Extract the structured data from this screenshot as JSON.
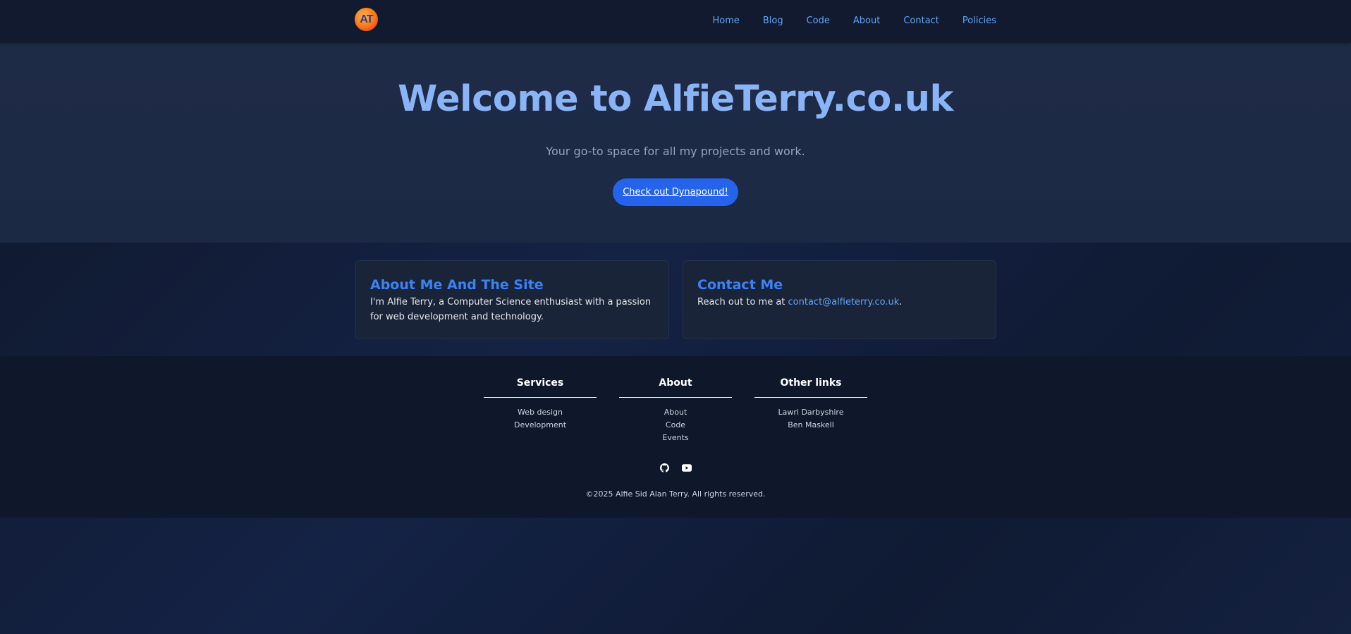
{
  "nav": {
    "logo_text": "AT",
    "links": [
      "Home",
      "Blog",
      "Code",
      "About",
      "Contact",
      "Policies"
    ]
  },
  "hero": {
    "title": "Welcome to AlfieTerry.co.uk",
    "subtitle": "Your go-to space for all my projects and work.",
    "cta_label": "Check out Dynapound!"
  },
  "cards": {
    "about": {
      "title": "About Me And The Site",
      "text": "I'm Alfie Terry, a Computer Science enthusiast with a passion for web development and technology."
    },
    "contact": {
      "title": "Contact Me",
      "text_prefix": "Reach out to me at ",
      "email": "contact@alfieterry.co.uk",
      "text_suffix": "."
    }
  },
  "footer": {
    "columns": [
      {
        "title": "Services",
        "items": [
          "Web design",
          "Development"
        ]
      },
      {
        "title": "About",
        "items": [
          "About",
          "Code",
          "Events"
        ]
      },
      {
        "title": "Other links",
        "items": [
          "Lawri Darbyshire",
          "Ben Maskell"
        ]
      }
    ],
    "social_icons": [
      "github-icon",
      "youtube-icon"
    ],
    "copyright": "©2025 Alfie Sid Alan Terry. All rights reserved."
  },
  "colors": {
    "accent": "#3b82f6",
    "link": "#60a5fa",
    "cta": "#2563eb",
    "hero_title": "#8ab4f8"
  }
}
